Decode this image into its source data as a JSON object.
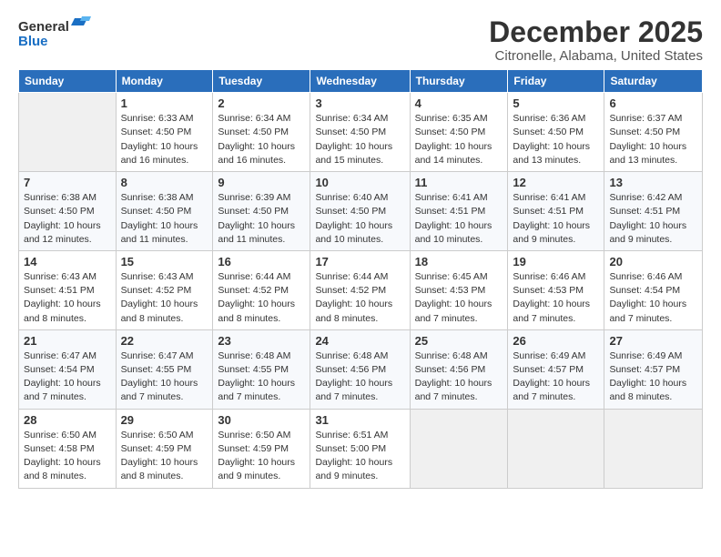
{
  "logo": {
    "general": "General",
    "blue": "Blue"
  },
  "title": "December 2025",
  "location": "Citronelle, Alabama, United States",
  "weekdays": [
    "Sunday",
    "Monday",
    "Tuesday",
    "Wednesday",
    "Thursday",
    "Friday",
    "Saturday"
  ],
  "rows": [
    [
      {
        "day": "",
        "sunrise": "",
        "sunset": "",
        "daylight": ""
      },
      {
        "day": "1",
        "sunrise": "Sunrise: 6:33 AM",
        "sunset": "Sunset: 4:50 PM",
        "daylight": "Daylight: 10 hours and 16 minutes."
      },
      {
        "day": "2",
        "sunrise": "Sunrise: 6:34 AM",
        "sunset": "Sunset: 4:50 PM",
        "daylight": "Daylight: 10 hours and 16 minutes."
      },
      {
        "day": "3",
        "sunrise": "Sunrise: 6:34 AM",
        "sunset": "Sunset: 4:50 PM",
        "daylight": "Daylight: 10 hours and 15 minutes."
      },
      {
        "day": "4",
        "sunrise": "Sunrise: 6:35 AM",
        "sunset": "Sunset: 4:50 PM",
        "daylight": "Daylight: 10 hours and 14 minutes."
      },
      {
        "day": "5",
        "sunrise": "Sunrise: 6:36 AM",
        "sunset": "Sunset: 4:50 PM",
        "daylight": "Daylight: 10 hours and 13 minutes."
      },
      {
        "day": "6",
        "sunrise": "Sunrise: 6:37 AM",
        "sunset": "Sunset: 4:50 PM",
        "daylight": "Daylight: 10 hours and 13 minutes."
      }
    ],
    [
      {
        "day": "7",
        "sunrise": "Sunrise: 6:38 AM",
        "sunset": "Sunset: 4:50 PM",
        "daylight": "Daylight: 10 hours and 12 minutes."
      },
      {
        "day": "8",
        "sunrise": "Sunrise: 6:38 AM",
        "sunset": "Sunset: 4:50 PM",
        "daylight": "Daylight: 10 hours and 11 minutes."
      },
      {
        "day": "9",
        "sunrise": "Sunrise: 6:39 AM",
        "sunset": "Sunset: 4:50 PM",
        "daylight": "Daylight: 10 hours and 11 minutes."
      },
      {
        "day": "10",
        "sunrise": "Sunrise: 6:40 AM",
        "sunset": "Sunset: 4:50 PM",
        "daylight": "Daylight: 10 hours and 10 minutes."
      },
      {
        "day": "11",
        "sunrise": "Sunrise: 6:41 AM",
        "sunset": "Sunset: 4:51 PM",
        "daylight": "Daylight: 10 hours and 10 minutes."
      },
      {
        "day": "12",
        "sunrise": "Sunrise: 6:41 AM",
        "sunset": "Sunset: 4:51 PM",
        "daylight": "Daylight: 10 hours and 9 minutes."
      },
      {
        "day": "13",
        "sunrise": "Sunrise: 6:42 AM",
        "sunset": "Sunset: 4:51 PM",
        "daylight": "Daylight: 10 hours and 9 minutes."
      }
    ],
    [
      {
        "day": "14",
        "sunrise": "Sunrise: 6:43 AM",
        "sunset": "Sunset: 4:51 PM",
        "daylight": "Daylight: 10 hours and 8 minutes."
      },
      {
        "day": "15",
        "sunrise": "Sunrise: 6:43 AM",
        "sunset": "Sunset: 4:52 PM",
        "daylight": "Daylight: 10 hours and 8 minutes."
      },
      {
        "day": "16",
        "sunrise": "Sunrise: 6:44 AM",
        "sunset": "Sunset: 4:52 PM",
        "daylight": "Daylight: 10 hours and 8 minutes."
      },
      {
        "day": "17",
        "sunrise": "Sunrise: 6:44 AM",
        "sunset": "Sunset: 4:52 PM",
        "daylight": "Daylight: 10 hours and 8 minutes."
      },
      {
        "day": "18",
        "sunrise": "Sunrise: 6:45 AM",
        "sunset": "Sunset: 4:53 PM",
        "daylight": "Daylight: 10 hours and 7 minutes."
      },
      {
        "day": "19",
        "sunrise": "Sunrise: 6:46 AM",
        "sunset": "Sunset: 4:53 PM",
        "daylight": "Daylight: 10 hours and 7 minutes."
      },
      {
        "day": "20",
        "sunrise": "Sunrise: 6:46 AM",
        "sunset": "Sunset: 4:54 PM",
        "daylight": "Daylight: 10 hours and 7 minutes."
      }
    ],
    [
      {
        "day": "21",
        "sunrise": "Sunrise: 6:47 AM",
        "sunset": "Sunset: 4:54 PM",
        "daylight": "Daylight: 10 hours and 7 minutes."
      },
      {
        "day": "22",
        "sunrise": "Sunrise: 6:47 AM",
        "sunset": "Sunset: 4:55 PM",
        "daylight": "Daylight: 10 hours and 7 minutes."
      },
      {
        "day": "23",
        "sunrise": "Sunrise: 6:48 AM",
        "sunset": "Sunset: 4:55 PM",
        "daylight": "Daylight: 10 hours and 7 minutes."
      },
      {
        "day": "24",
        "sunrise": "Sunrise: 6:48 AM",
        "sunset": "Sunset: 4:56 PM",
        "daylight": "Daylight: 10 hours and 7 minutes."
      },
      {
        "day": "25",
        "sunrise": "Sunrise: 6:48 AM",
        "sunset": "Sunset: 4:56 PM",
        "daylight": "Daylight: 10 hours and 7 minutes."
      },
      {
        "day": "26",
        "sunrise": "Sunrise: 6:49 AM",
        "sunset": "Sunset: 4:57 PM",
        "daylight": "Daylight: 10 hours and 7 minutes."
      },
      {
        "day": "27",
        "sunrise": "Sunrise: 6:49 AM",
        "sunset": "Sunset: 4:57 PM",
        "daylight": "Daylight: 10 hours and 8 minutes."
      }
    ],
    [
      {
        "day": "28",
        "sunrise": "Sunrise: 6:50 AM",
        "sunset": "Sunset: 4:58 PM",
        "daylight": "Daylight: 10 hours and 8 minutes."
      },
      {
        "day": "29",
        "sunrise": "Sunrise: 6:50 AM",
        "sunset": "Sunset: 4:59 PM",
        "daylight": "Daylight: 10 hours and 8 minutes."
      },
      {
        "day": "30",
        "sunrise": "Sunrise: 6:50 AM",
        "sunset": "Sunset: 4:59 PM",
        "daylight": "Daylight: 10 hours and 9 minutes."
      },
      {
        "day": "31",
        "sunrise": "Sunrise: 6:51 AM",
        "sunset": "Sunset: 5:00 PM",
        "daylight": "Daylight: 10 hours and 9 minutes."
      },
      {
        "day": "",
        "sunrise": "",
        "sunset": "",
        "daylight": ""
      },
      {
        "day": "",
        "sunrise": "",
        "sunset": "",
        "daylight": ""
      },
      {
        "day": "",
        "sunrise": "",
        "sunset": "",
        "daylight": ""
      }
    ]
  ]
}
